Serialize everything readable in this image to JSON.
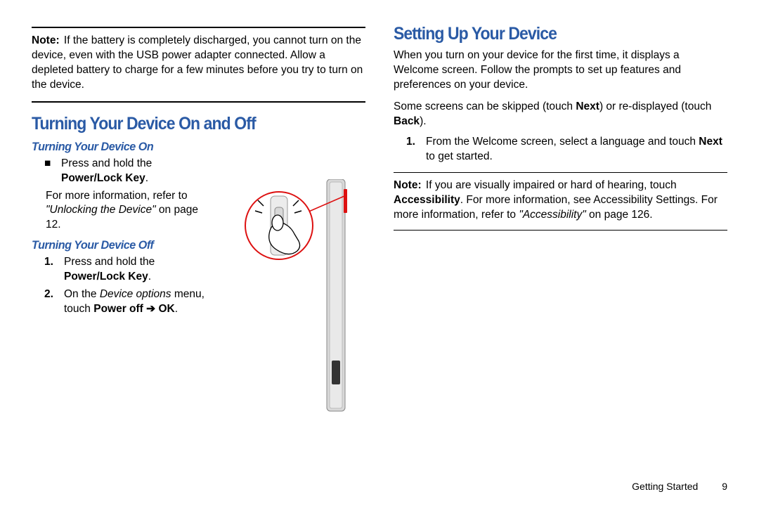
{
  "left": {
    "note": {
      "label": "Note:",
      "text": "If the battery is completely discharged, you cannot turn on the device, even with the USB power adapter connected. Allow a depleted battery to charge for a few minutes before you try to turn on the device."
    },
    "h1": "Turning Your Device On and Off",
    "on": {
      "title": "Turning Your Device On",
      "bullet_pre": "Press and hold the ",
      "bullet_key": "Power/Lock Key",
      "info_pre": "For more information, refer to ",
      "info_ref": "\"Unlocking the Device\"",
      "info_post": " on page 12."
    },
    "off": {
      "title": "Turning Your Device Off",
      "step1_pre": "Press and hold the ",
      "step1_key": "Power/Lock Key",
      "step2_pre": "On the ",
      "step2_menu": "Device options",
      "step2_mid": " menu, touch ",
      "step2_poweroff": "Power off",
      "step2_arrow": " ➔ ",
      "step2_ok": "OK",
      "num1": "1.",
      "num2": "2."
    }
  },
  "right": {
    "h1": "Setting Up Your Device",
    "p1": "When you turn on your device for the first time, it displays a Welcome screen. Follow the prompts to set up features and preferences on your device.",
    "p2_pre": "Some screens can be skipped (touch ",
    "p2_next": "Next",
    "p2_mid": ") or re-displayed (touch ",
    "p2_back": "Back",
    "p2_end": ").",
    "step1_pre": "From the Welcome screen, select a language and touch ",
    "step1_next": "Next",
    "step1_end": " to get started.",
    "num1": "1.",
    "note": {
      "label": "Note:",
      "pre": "If you are visually impaired or hard of hearing, touch ",
      "acc": "Accessibility",
      "mid": ". For more information, see Accessibility Settings. For more information, refer to ",
      "ref": "\"Accessibility\"",
      "end": " on page 126."
    },
    "footer_section": "Getting Started",
    "footer_page": "9"
  }
}
